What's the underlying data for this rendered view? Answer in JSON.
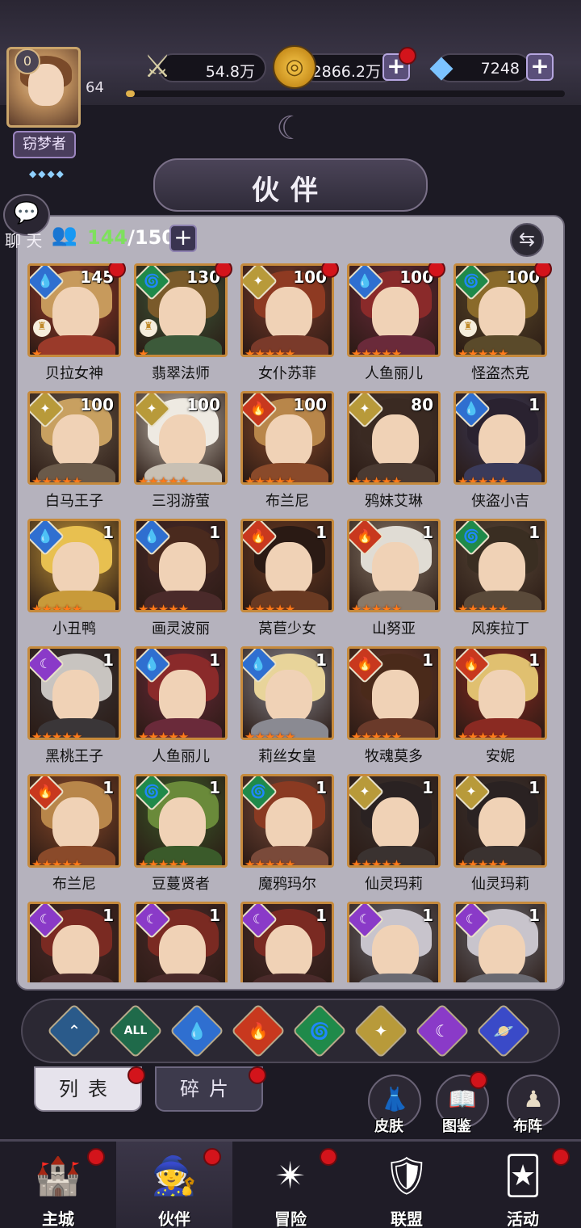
{
  "header": {
    "vip_level": "0",
    "player_level": "64",
    "player_title": "窃梦者",
    "title_gems": "◆◆◆◆",
    "power": "54.8万",
    "gold": "2866.2万",
    "gems": "7248",
    "exp_progress": 0.02,
    "page_title": "伙伴"
  },
  "chat": {
    "label": "聊 天"
  },
  "roster": {
    "count_current": "144",
    "count_separator": "/",
    "count_max": "150"
  },
  "heroes": [
    {
      "name": "贝拉女神",
      "level": "145",
      "element": "water",
      "stars": 1,
      "lock": true,
      "reddot": true,
      "color": "#9a3a2a",
      "hair": "#c79a5c"
    },
    {
      "name": "翡翠法师",
      "level": "130",
      "element": "wind",
      "stars": 1,
      "lock": true,
      "reddot": true,
      "color": "#3c5a3a",
      "hair": "#7a5a2a"
    },
    {
      "name": "女仆苏菲",
      "level": "100",
      "element": "light",
      "stars": 5,
      "lock": false,
      "reddot": true,
      "color": "#7a3a2a",
      "hair": "#8e3a22"
    },
    {
      "name": "人鱼丽儿",
      "level": "100",
      "element": "water",
      "stars": 5,
      "lock": false,
      "reddot": true,
      "color": "#6a2a3a",
      "hair": "#8a2a2a"
    },
    {
      "name": "怪盗杰克",
      "level": "100",
      "element": "wind",
      "stars": 5,
      "lock": true,
      "reddot": true,
      "color": "#5a4a2a",
      "hair": "#8a6a2a"
    },
    {
      "name": "白马王子",
      "level": "100",
      "element": "light",
      "stars": 5,
      "lock": false,
      "reddot": false,
      "color": "#6a5a4a",
      "hair": "#c8a060"
    },
    {
      "name": "三羽游萤",
      "level": "100",
      "element": "light",
      "stars": 5,
      "lock": false,
      "reddot": false,
      "color": "#c8c0b4",
      "hair": "#eeeae2"
    },
    {
      "name": "布兰尼",
      "level": "100",
      "element": "fire",
      "stars": 5,
      "lock": false,
      "reddot": false,
      "color": "#8a4a2a",
      "hair": "#b8864a"
    },
    {
      "name": "鸦妹艾琳",
      "level": "80",
      "element": "light",
      "stars": 5,
      "lock": false,
      "reddot": false,
      "color": "#4a3a32",
      "hair": "#3a2a22"
    },
    {
      "name": "侠盗小吉",
      "level": "1",
      "element": "water",
      "stars": 5,
      "lock": false,
      "reddot": false,
      "color": "#3a3a5a",
      "hair": "#2a2230"
    },
    {
      "name": "小丑鸭",
      "level": "1",
      "element": "water",
      "stars": 5,
      "lock": false,
      "reddot": false,
      "color": "#c89a3a",
      "hair": "#e8c050"
    },
    {
      "name": "画灵波丽",
      "level": "1",
      "element": "water",
      "stars": 5,
      "lock": false,
      "reddot": false,
      "color": "#4a2a2a",
      "hair": "#4a2a1e"
    },
    {
      "name": "莴苣少女",
      "level": "1",
      "element": "fire",
      "stars": 5,
      "lock": false,
      "reddot": false,
      "color": "#6a3a22",
      "hair": "#2a1a14"
    },
    {
      "name": "山努亚",
      "level": "1",
      "element": "fire",
      "stars": 5,
      "lock": false,
      "reddot": false,
      "color": "#8a7a6a",
      "hair": "#e0dcd4"
    },
    {
      "name": "风疾拉丁",
      "level": "1",
      "element": "wind",
      "stars": 5,
      "lock": false,
      "reddot": false,
      "color": "#5a4a3a",
      "hair": "#3a2e22"
    },
    {
      "name": "黑桃王子",
      "level": "1",
      "element": "dark",
      "stars": 5,
      "lock": false,
      "reddot": false,
      "color": "#3a3638",
      "hair": "#c8c4c0"
    },
    {
      "name": "人鱼丽儿",
      "level": "1",
      "element": "water",
      "stars": 5,
      "lock": false,
      "reddot": false,
      "color": "#6a2a3a",
      "hair": "#8a2a2a"
    },
    {
      "name": "莉丝女皇",
      "level": "1",
      "element": "water",
      "stars": 5,
      "lock": false,
      "reddot": false,
      "color": "#8a8a92",
      "hair": "#e8d49a"
    },
    {
      "name": "牧魂莫多",
      "level": "1",
      "element": "fire",
      "stars": 5,
      "lock": false,
      "reddot": false,
      "color": "#6a3a2a",
      "hair": "#4a2a1a"
    },
    {
      "name": "安妮",
      "level": "1",
      "element": "fire",
      "stars": 5,
      "lock": false,
      "reddot": false,
      "color": "#8a2a22",
      "hair": "#e0c070"
    },
    {
      "name": "布兰尼",
      "level": "1",
      "element": "fire",
      "stars": 5,
      "lock": false,
      "reddot": false,
      "color": "#8a4a2a",
      "hair": "#b8864a"
    },
    {
      "name": "豆蔓贤者",
      "level": "1",
      "element": "wind",
      "stars": 5,
      "lock": false,
      "reddot": false,
      "color": "#3a5a2a",
      "hair": "#6a8a3a"
    },
    {
      "name": "魔鸦玛尔",
      "level": "1",
      "element": "wind",
      "stars": 5,
      "lock": false,
      "reddot": false,
      "color": "#7a4a3a",
      "hair": "#8a3a22"
    },
    {
      "name": "仙灵玛莉",
      "level": "1",
      "element": "light",
      "stars": 5,
      "lock": false,
      "reddot": false,
      "color": "#3a3230",
      "hair": "#2a2222"
    },
    {
      "name": "仙灵玛莉",
      "level": "1",
      "element": "light",
      "stars": 5,
      "lock": false,
      "reddot": false,
      "color": "#3a3230",
      "hair": "#2a2222"
    },
    {
      "name": "",
      "level": "1",
      "element": "dark",
      "stars": 0,
      "lock": false,
      "reddot": false,
      "color": "#4a2a2a",
      "hair": "#7a2a22"
    },
    {
      "name": "",
      "level": "1",
      "element": "dark",
      "stars": 0,
      "lock": false,
      "reddot": false,
      "color": "#4a2a2a",
      "hair": "#7a2a22"
    },
    {
      "name": "",
      "level": "1",
      "element": "dark",
      "stars": 0,
      "lock": false,
      "reddot": false,
      "color": "#4a2a2a",
      "hair": "#7a2a22"
    },
    {
      "name": "",
      "level": "1",
      "element": "dark",
      "stars": 0,
      "lock": false,
      "reddot": false,
      "color": "#6a6a72",
      "hair": "#c8c4cc"
    },
    {
      "name": "",
      "level": "1",
      "element": "dark",
      "stars": 0,
      "lock": false,
      "reddot": false,
      "color": "#6a6a72",
      "hair": "#c8c4cc"
    }
  ],
  "element_styles": {
    "water": {
      "bg": "#2f6fd0",
      "glyph": "💧"
    },
    "wind": {
      "bg": "#1f8a4a",
      "glyph": "🌀"
    },
    "light": {
      "bg": "#b89a3a",
      "glyph": "✦"
    },
    "fire": {
      "bg": "#c8381e",
      "glyph": "🔥"
    },
    "dark": {
      "bg": "#8a3ac8",
      "glyph": "☾"
    },
    "space": {
      "bg": "#3a4ac8",
      "glyph": "🪐"
    },
    "all": {
      "bg": "#1f6a4a",
      "glyph": "ALL"
    },
    "up": {
      "bg": "#2a5a8a",
      "glyph": "⌃"
    }
  },
  "filters": [
    "up",
    "all",
    "water",
    "fire",
    "wind",
    "light",
    "dark",
    "space"
  ],
  "tabs": {
    "list": "列表",
    "fragments": "碎片"
  },
  "side_buttons": {
    "skins": "皮肤",
    "codex": "图鉴",
    "formation": "布阵"
  },
  "nav": [
    {
      "label": "主城",
      "icon": "🏰",
      "active": false,
      "reddot": true
    },
    {
      "label": "伙伴",
      "icon": "🧙",
      "active": true,
      "reddot": true
    },
    {
      "label": "冒险",
      "icon": "✴",
      "active": false,
      "reddot": true
    },
    {
      "label": "联盟",
      "icon": "🛡",
      "active": false,
      "reddot": false
    },
    {
      "label": "活动",
      "icon": "🃏",
      "active": false,
      "reddot": true
    }
  ],
  "colors": {
    "accent": "#d3141b",
    "panel": "#b5b2bd",
    "card_border": "#c68a3c",
    "star": "#ff7a1a",
    "count_green": "#7ee05d"
  }
}
